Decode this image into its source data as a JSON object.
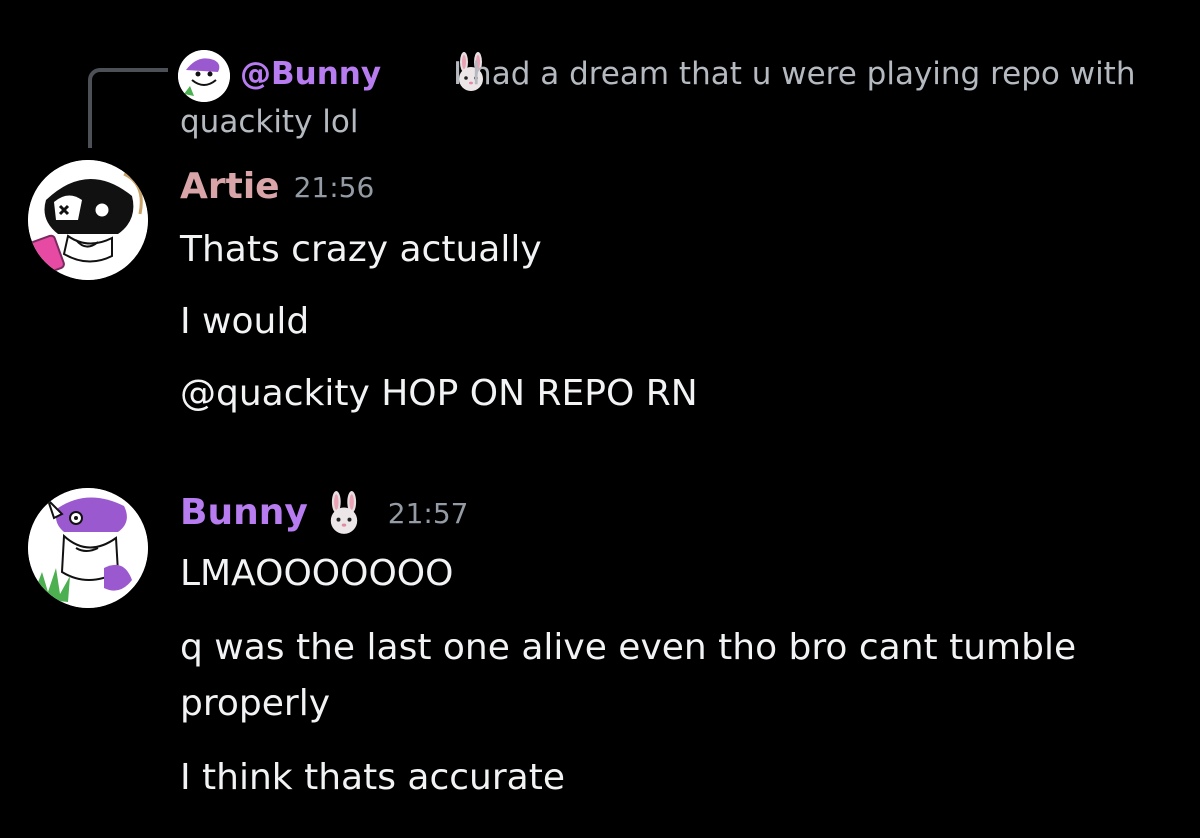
{
  "reply": {
    "author": "@Bunny",
    "author_emoji": "rabbit-face-emoji",
    "text": "I had a dream that u were playing repo with quackity lol"
  },
  "messages": [
    {
      "author": "Artie",
      "author_color": "#d9a5a9",
      "timestamp": "21:56",
      "lines": [
        "Thats crazy actually",
        "I would",
        "@quackity HOP ON REPO RN"
      ]
    },
    {
      "author": "Bunny",
      "author_color": "#b77cf0",
      "author_emoji": "rabbit-face-emoji",
      "timestamp": "21:57",
      "lines": [
        "LMAOOOOOOO",
        "q was the last one alive even tho bro cant tumble properly",
        "I think thats accurate"
      ]
    }
  ],
  "colors": {
    "background": "#000000",
    "text": "#f2f3f5",
    "muted": "#949ba4",
    "reply_line": "#4e5058",
    "accent_purple": "#b77cf0"
  }
}
